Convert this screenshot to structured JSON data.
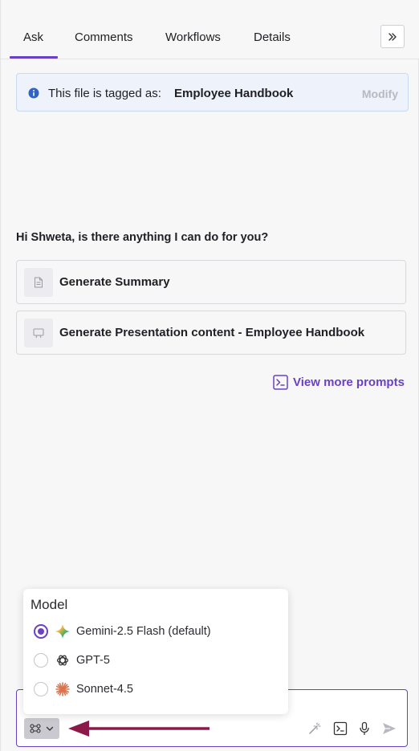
{
  "tabs": [
    {
      "label": "Ask",
      "active": true
    },
    {
      "label": "Comments",
      "active": false
    },
    {
      "label": "Workflows",
      "active": false
    },
    {
      "label": "Details",
      "active": false
    }
  ],
  "tag_banner": {
    "text": "This file is tagged as:",
    "value": "Employee Handbook",
    "action": "Modify",
    "icon": "info-icon"
  },
  "greeting": "Hi Shweta, is there anything I can do for you?",
  "prompts": [
    {
      "label": "Generate Summary",
      "icon": "document-icon"
    },
    {
      "label": "Generate Presentation content - Employee Handbook",
      "icon": "presentation-icon"
    }
  ],
  "view_more": {
    "label": "View more prompts",
    "icon": "terminal-prompt-icon"
  },
  "model_menu": {
    "title": "Model",
    "options": [
      {
        "label": "Gemini-2.5 Flash (default)",
        "selected": true,
        "icon": "gemini-icon"
      },
      {
        "label": "GPT-5",
        "selected": false,
        "icon": "openai-icon"
      },
      {
        "label": "Sonnet-4.5",
        "selected": false,
        "icon": "anthropic-icon"
      }
    ]
  },
  "toolbar": {
    "icons": [
      "magic-wand-icon",
      "terminal-prompt-icon",
      "microphone-icon",
      "send-icon"
    ]
  },
  "colors": {
    "accent": "#6a40c4",
    "annotation_arrow": "#8b1a4a",
    "banner_bg": "#eef3fb",
    "info_icon": "#2f63c4"
  }
}
